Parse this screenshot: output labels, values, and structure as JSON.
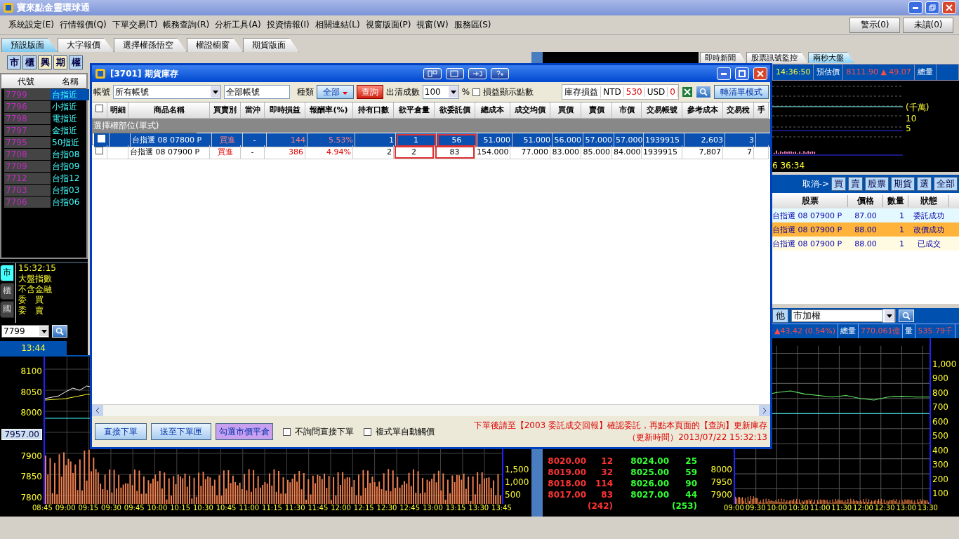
{
  "window": {
    "title": "寶來點金靈環球通"
  },
  "menu": [
    "系統設定(E)",
    "行情報價(Q)",
    "下單交易(T)",
    "帳務查詢(R)",
    "分析工具(A)",
    "投資情報(I)",
    "相關連結(L)",
    "視窗版面(P)",
    "視窗(W)",
    "服務區(S)"
  ],
  "alerts": [
    "警示(0)",
    "未讀(0)"
  ],
  "layout_tabs": [
    {
      "label": "預設版面",
      "selected": true
    },
    {
      "label": "大字報價",
      "selected": false
    },
    {
      "label": "選擇權孫悟空",
      "selected": false
    },
    {
      "label": "權證櫥窗",
      "selected": false
    },
    {
      "label": "期貨版面",
      "selected": false
    }
  ],
  "toolbar": [
    {
      "label": "市",
      "selected": false
    },
    {
      "label": "櫃",
      "selected": false
    },
    {
      "label": "興",
      "selected": true
    },
    {
      "label": "期",
      "selected": true
    },
    {
      "label": "權",
      "selected": false
    }
  ],
  "quote_list": {
    "columns": [
      "代號",
      "名稱"
    ],
    "rows": [
      {
        "code": "7799",
        "name": "台指近",
        "selected": true
      },
      {
        "code": "7796",
        "name": "小指近",
        "selected": false
      },
      {
        "code": "7798",
        "name": "電指近",
        "selected": false
      },
      {
        "code": "7797",
        "name": "金指近",
        "selected": false
      },
      {
        "code": "7795",
        "name": "50指近",
        "selected": false
      },
      {
        "code": "7708",
        "name": "台指08",
        "selected": false
      },
      {
        "code": "7709",
        "name": "台指09",
        "selected": false
      },
      {
        "code": "7712",
        "name": "台指12",
        "selected": false
      },
      {
        "code": "7703",
        "name": "台指03",
        "selected": false
      },
      {
        "code": "7706",
        "name": "台指06",
        "selected": false
      }
    ]
  },
  "index_panel": {
    "tabs": [
      {
        "label": "市",
        "selected": true
      },
      {
        "label": "櫃",
        "selected": false
      },
      {
        "label": "國",
        "selected": false
      }
    ],
    "lines": [
      "15:32:15",
      "大盤指數",
      "不含金融",
      "委　買",
      "委　賣"
    ]
  },
  "symbol_box": {
    "value": "7799"
  },
  "chart_time": "13:44",
  "left_chart": {
    "price_ticks_upper": [
      "8100",
      "8050",
      "8000"
    ],
    "price_tag": "7957.00",
    "price_ticks_lower": [
      "7900",
      "7850",
      "7800"
    ],
    "volume_ticks": [
      "1,500",
      "1,000",
      "500"
    ],
    "x_ticks": [
      "08:45",
      "09:00",
      "09:15",
      "09:30",
      "09:45",
      "10:00",
      "10:15",
      "10:30",
      "10:45",
      "11:00",
      "11:15",
      "11:30",
      "11:45",
      "12:00",
      "12:15",
      "12:30",
      "12:45",
      "13:00",
      "13:15",
      "13:30",
      "13:45"
    ]
  },
  "order_book": {
    "rows": [
      {
        "bid": "8020.00",
        "bid_qty": "12",
        "ask": "8024.00",
        "ask_qty": "25"
      },
      {
        "bid": "8019.00",
        "bid_qty": "32",
        "ask": "8025.00",
        "ask_qty": "59"
      },
      {
        "bid": "8018.00",
        "bid_qty": "114",
        "ask": "8026.00",
        "ask_qty": "90"
      },
      {
        "bid": "8017.00",
        "bid_qty": "83",
        "ask": "8027.00",
        "ask_qty": "44"
      }
    ],
    "totals": [
      "(242)",
      "(253)"
    ]
  },
  "right_tabs": [
    {
      "label": "即時新聞",
      "selected": false
    },
    {
      "label": "股票訊號監控",
      "selected": false
    },
    {
      "label": "兩秒大盤",
      "selected": true
    }
  ],
  "index_header": {
    "time": "14:36:50",
    "label": "預估價",
    "value": "8111.90 ▲ 49.07",
    "volume_label": "總量"
  },
  "mini_chart": {
    "unit": "(千萬)",
    "ticks": [
      "10",
      "5"
    ],
    "time": "6 36:34"
  },
  "orders": {
    "cancel_label": "取消->",
    "cancel_buttons": [
      "買",
      "賣",
      "股票",
      "期貨",
      "選",
      "全部"
    ],
    "columns": [
      "股票",
      "價格",
      "數量",
      "狀態"
    ],
    "rows": [
      {
        "product": "台指選 08 07900 P",
        "price": "87.00",
        "qty": "1",
        "status": "委託成功",
        "color": "#e4f8ff"
      },
      {
        "product": "台指選 08 07900 P",
        "price": "88.00",
        "qty": "1",
        "status": "改價成功",
        "color": "#ffb33a"
      },
      {
        "product": "台指選 08 07900 P",
        "price": "88.00",
        "qty": "1",
        "status": "已成交",
        "color": "#fffbe3"
      }
    ]
  },
  "market": {
    "category": "他",
    "index_select": "市加權",
    "change": "▲43.42 (0.54%)",
    "volume_label": "總量",
    "volume": "770.061億",
    "qty_label": "量",
    "qty": "535.79千"
  },
  "right_chart": {
    "left_ticks": [
      "8000",
      "7950",
      "7900"
    ],
    "right_ticks": [
      "1,000",
      "900",
      "800",
      "700",
      "600",
      "500",
      "400",
      "300",
      "200",
      "100"
    ],
    "x_ticks": [
      "09:00",
      "09:30",
      "10:00",
      "10:30",
      "11:00",
      "11:30",
      "12:00",
      "12:30",
      "13:00",
      "13:30"
    ]
  },
  "dialog": {
    "title": "[3701] 期貨庫存",
    "account_label": "帳號",
    "account": "所有帳號",
    "account_name": "全部帳號",
    "type_label": "種類",
    "type": "全部",
    "query": "查詢",
    "clear_label": "出清成數",
    "clear_ratio": "100",
    "percent": "%",
    "show_points": {
      "label": "損益顯示點數",
      "checked": false
    },
    "pnl_label": "庫存損益",
    "currencies": [
      {
        "code": "NTD",
        "value": "530"
      },
      {
        "code": "USD",
        "value": "0"
      }
    ],
    "list_mode": "轉清單模式",
    "header_checked": false,
    "columns": [
      "明細",
      "商品名稱",
      "買賣別",
      "當沖",
      "即時損益",
      "報酬率(%)",
      "持有口數",
      "欲平倉量",
      "欲委託價",
      "總成本",
      "成交均價",
      "買價",
      "賣價",
      "市價",
      "交易帳號",
      "參考成本",
      "交易稅",
      "手"
    ],
    "group": "選擇權部位(單式)",
    "rows": [
      {
        "checked": false,
        "selected": true,
        "product": "台指選 08 07800 P",
        "side": "買進",
        "daytrade": "-",
        "pnl": "144",
        "return": "5.53%",
        "qty": "1",
        "close_qty": "1",
        "order_price": "56",
        "total_cost": "51.000",
        "avg_price": "51.000",
        "bid": "56.000",
        "ask": "57.000",
        "market": "57.000",
        "account": "1939915",
        "ref_cost": "2,603",
        "tax": "3"
      },
      {
        "checked": false,
        "selected": false,
        "product": "台指選 08 07900 P",
        "side": "買進",
        "daytrade": "-",
        "pnl": "386",
        "return": "4.94%",
        "qty": "2",
        "close_qty": "2",
        "order_price": "83",
        "total_cost": "154.000",
        "avg_price": "77.000",
        "bid": "83.000",
        "ask": "85.000",
        "market": "84.000",
        "account": "1939915",
        "ref_cost": "7,807",
        "tax": "7"
      }
    ],
    "buttons": [
      "直接下單",
      "送至下單匣",
      "勾選市價平倉"
    ],
    "options": [
      {
        "label": "不詢問直接下單",
        "checked": false
      },
      {
        "label": "複式單自動觸價",
        "checked": false
      }
    ],
    "notes": [
      "下單後請至【2003 委託成交回報】確認委託，再點本頁面的【查詢】更新庫存",
      "（更新時間）2013/07/22 15:32:13"
    ]
  }
}
